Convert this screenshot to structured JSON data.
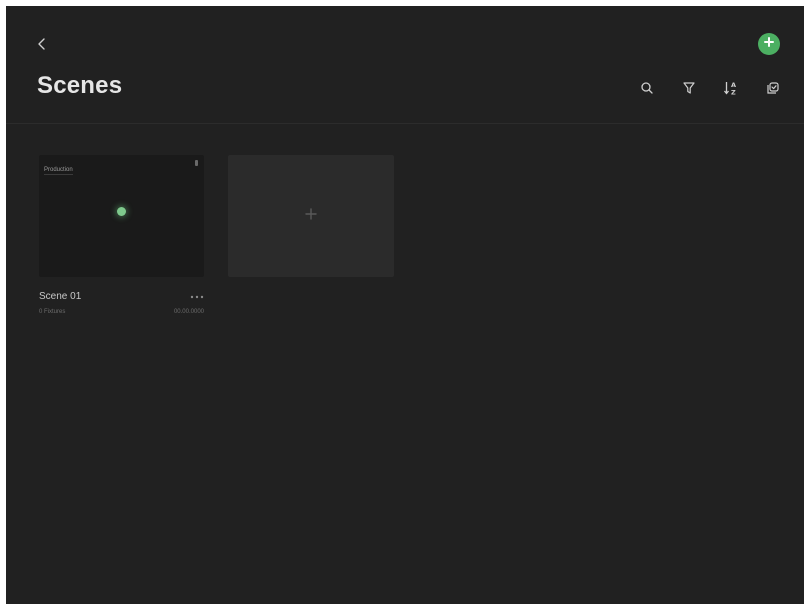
{
  "header": {
    "title": "Scenes",
    "back_icon": "chevron-left-icon",
    "add_icon": "plus-circle-icon",
    "accent_color": "#4caf62"
  },
  "toolbar": {
    "icons": [
      "search-icon",
      "filter-icon",
      "sort-az-icon",
      "select-icon"
    ]
  },
  "scenes": [
    {
      "name": "Scene 01",
      "thumbnail_tag": "Production",
      "meta_left": "0 Fixtures",
      "meta_right": "00.00.0000"
    }
  ],
  "new_scene": {
    "icon": "plus-icon"
  }
}
